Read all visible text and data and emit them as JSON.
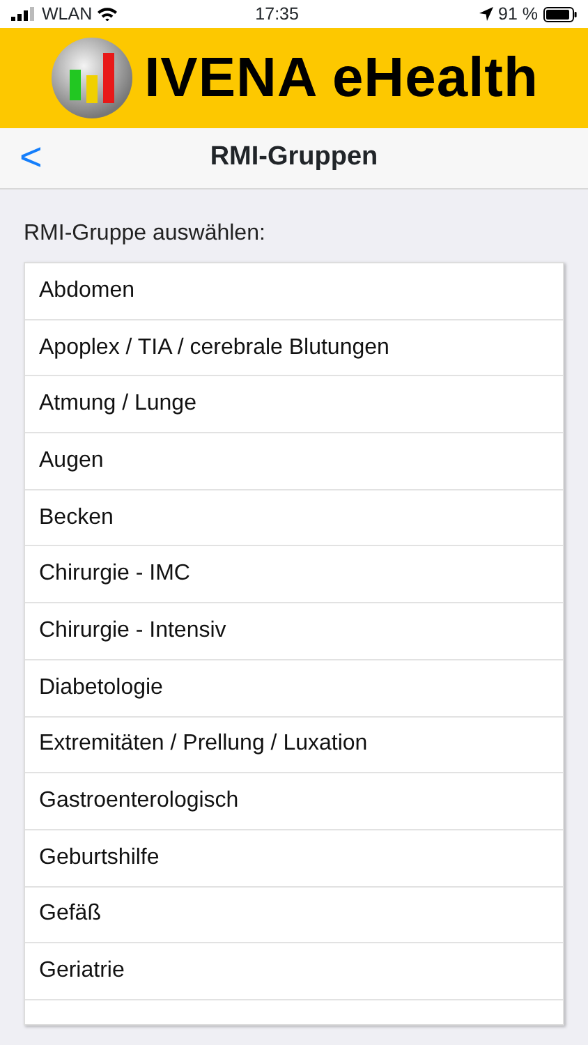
{
  "status_bar": {
    "carrier": "WLAN",
    "time": "17:35",
    "battery": "91 %"
  },
  "banner": {
    "title": "IVENA eHealth"
  },
  "nav_bar": {
    "back": "<",
    "title": "RMI-Gruppen"
  },
  "section_label": "RMI-Gruppe auswählen:",
  "items": [
    {
      "label": "Abdomen"
    },
    {
      "label": "Apoplex / TIA / cerebrale Blutungen"
    },
    {
      "label": "Atmung / Lunge"
    },
    {
      "label": "Augen"
    },
    {
      "label": "Becken"
    },
    {
      "label": "Chirurgie - IMC"
    },
    {
      "label": "Chirurgie - Intensiv"
    },
    {
      "label": "Diabetologie"
    },
    {
      "label": "Extremitäten / Prellung / Luxation"
    },
    {
      "label": "Gastroenterologisch"
    },
    {
      "label": "Geburtshilfe"
    },
    {
      "label": "Gefäß"
    },
    {
      "label": "Geriatrie"
    }
  ]
}
